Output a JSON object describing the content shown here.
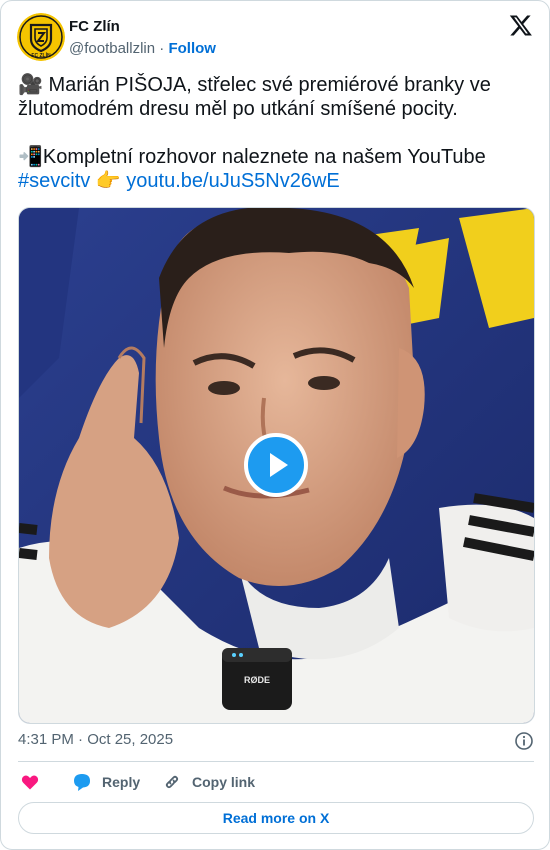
{
  "author": {
    "display_name": "FC Zlín",
    "handle": "@footballzlin",
    "separator": "·",
    "follow_label": "Follow",
    "avatar_text": "FC ZLÍN"
  },
  "tweet": {
    "line1_emoji": "🎥",
    "line1_text": " Marián PIŠOJA, střelec své premiérové branky ve žlutomodrém dresu měl po utkání smíšené pocity.",
    "line2_emoji": "📲",
    "line2_text": "Kompletní rozhovor naleznete na našem YouTube",
    "hashtag": "#sevcitv",
    "pointer_emoji": "👉",
    "url": "youtu.be/uJuS5Nv26wE"
  },
  "media": {
    "mic_brand": "RØDE"
  },
  "meta": {
    "timestamp": "4:31 PM · Oct 25, 2025"
  },
  "actions": {
    "reply_label": "Reply",
    "copy_label": "Copy link"
  },
  "footer": {
    "read_more_label": "Read more on X"
  },
  "colors": {
    "link": "#006fd6",
    "heart": "#f91880",
    "play": "#1d9bf0",
    "avatar_yellow": "#f5c400"
  }
}
